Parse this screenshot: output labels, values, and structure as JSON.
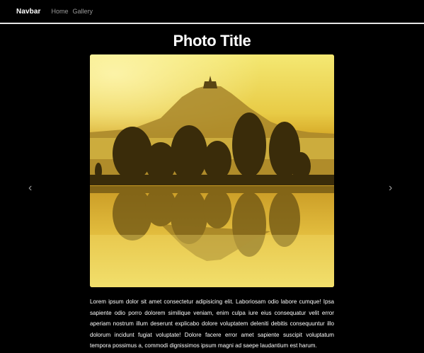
{
  "navbar": {
    "brand": "Navbar",
    "links": [
      {
        "label": "Home"
      },
      {
        "label": "Gallery"
      }
    ]
  },
  "photo": {
    "title": "Photo Title",
    "caption": "Lorem ipsum dolor sit amet consectetur adipisicing elit. Laboriosam odio labore cumque! Ipsa sapiente odio porro dolorem similique veniam, enim culpa iure eius consequatur velit error aperiam nostrum illum deserunt explicabo dolore voluptatem deleniti debitis consequuntur illo dolorum incidunt fugiat voluptate! Dolore facere error amet sapiente suscipit voluptatum tempora possimus a, commodi dignissimos ipsum magni ad saepe laudantium est harum."
  },
  "carousel": {
    "prev_icon": "chevron-left-icon",
    "next_icon": "chevron-right-icon",
    "prev_glyph": "‹",
    "next_glyph": "›"
  },
  "colors": {
    "background": "#000000",
    "navbar_border": "#e6e6e6",
    "nav_link": "#9a9a9a",
    "photo_sky": "#f2e46a",
    "photo_silhouette": "#3a2c0a"
  }
}
